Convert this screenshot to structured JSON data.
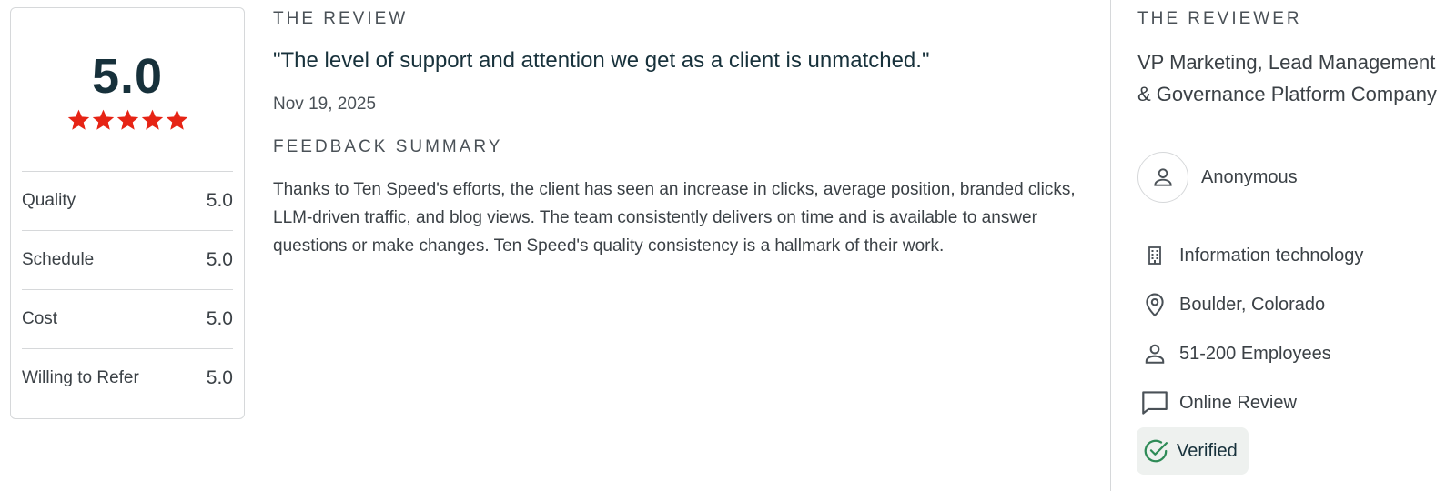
{
  "rating": {
    "overall": "5.0",
    "stars": 5,
    "star_color": "#e62415",
    "rows": [
      {
        "label": "Quality",
        "value": "5.0"
      },
      {
        "label": "Schedule",
        "value": "5.0"
      },
      {
        "label": "Cost",
        "value": "5.0"
      },
      {
        "label": "Willing to Refer",
        "value": "5.0"
      }
    ]
  },
  "review": {
    "heading": "THE REVIEW",
    "quote": "\"The level of support and attention we get as a client is unmatched.\"",
    "date": "Nov 19, 2025",
    "summary_heading": "FEEDBACK SUMMARY",
    "summary": "Thanks to Ten Speed's efforts, the client has seen an increase in clicks, average position, branded clicks, LLM-driven traffic, and blog views. The team consistently delivers on time and is available to answer questions or make changes. Ten Speed's quality consistency is a hallmark of their work."
  },
  "reviewer": {
    "heading": "THE REVIEWER",
    "title": "VP Marketing, Lead Management & Governance Platform Company",
    "name": "Anonymous",
    "details": [
      {
        "icon": "building-icon",
        "text": "Information technology"
      },
      {
        "icon": "location-pin-icon",
        "text": "Boulder, Colorado"
      },
      {
        "icon": "person-icon",
        "text": "51-200 Employees"
      },
      {
        "icon": "chat-bubble-icon",
        "text": "Online Review"
      }
    ],
    "verified_label": "Verified",
    "verified_color": "#2e8b57"
  }
}
